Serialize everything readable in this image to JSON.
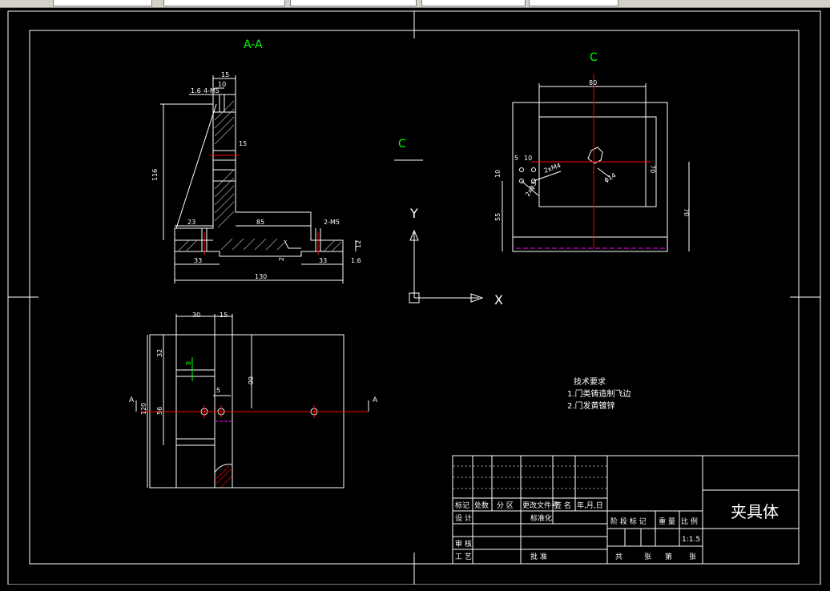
{
  "views": {
    "section_label": "A-A",
    "view_c_label": "C",
    "view_c_arrow_label": "C",
    "cut_arrow_left": "A",
    "cut_arrow_right": "A"
  },
  "ucs": {
    "y_label": "Y",
    "x_label": "X"
  },
  "dimensions": {
    "section": [
      "15",
      "10",
      "1.6",
      "4-M5",
      "116",
      "15",
      "23",
      "85",
      "2-M5",
      "12",
      "1.6",
      "33",
      "2",
      "33",
      "130"
    ],
    "top": [
      "30",
      "15",
      "32",
      "8",
      "60",
      "5",
      "56",
      "120"
    ],
    "view_c": [
      "80",
      "5",
      "10",
      "10",
      "2xM4",
      "2xϕ3",
      "ϕ14",
      "70",
      "55",
      "70"
    ]
  },
  "notes": {
    "heading": "技术要求",
    "lines": [
      "1.门类铸造制飞边",
      "2.门发黄镀锌"
    ]
  },
  "title_block": {
    "part_name": "夹具体",
    "scale": "1:1.5",
    "row_labels": [
      "标记",
      "处数",
      "分 区",
      "更改文件号",
      "签 名",
      "年,月,日"
    ],
    "design": "设 计",
    "standard": "标准化",
    "stage_header": [
      "阶 段 标 记",
      "重 量",
      "比 例"
    ],
    "review": "审 核",
    "process": "工 艺",
    "approve": "批 准",
    "sheets": [
      "共",
      "张",
      "第",
      "张"
    ]
  },
  "colors": {
    "green": "#00ff00",
    "red": "#ff0000",
    "magenta": "#ff00ff",
    "white": "#ffffff"
  }
}
